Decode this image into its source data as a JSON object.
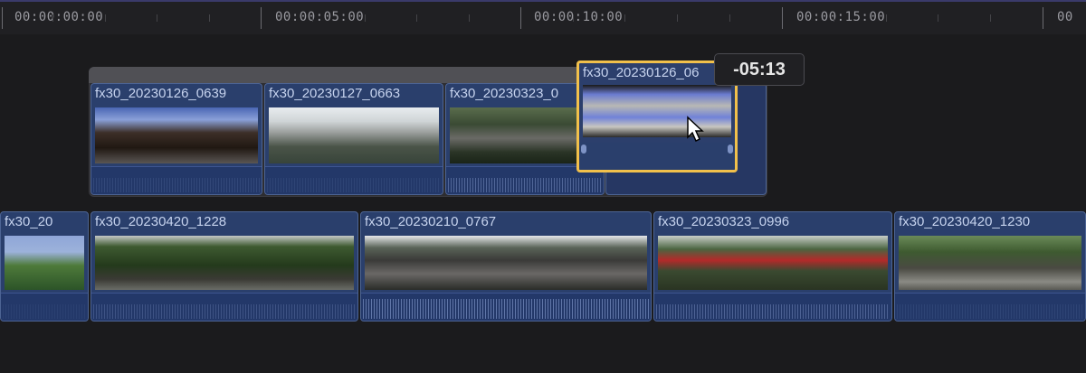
{
  "timeline": {
    "ruler_labels": [
      "00:00:00:00",
      "00:00:05:00",
      "00:00:10:00",
      "00:00:15:00",
      "00"
    ],
    "drag_offset": "-05:13"
  },
  "storyline_clips": [
    {
      "name": "fx30_20230126_0639"
    },
    {
      "name": "fx30_20230127_0663"
    },
    {
      "name": "fx30_20230323_0"
    },
    {
      "name": "fx30_20230126_06"
    }
  ],
  "primary_clips": [
    {
      "name": "fx30_20"
    },
    {
      "name": "fx30_20230420_1228"
    },
    {
      "name": "fx30_20230210_0767"
    },
    {
      "name": "fx30_20230323_0996"
    },
    {
      "name": "fx30_20230420_1230"
    }
  ],
  "colors": {
    "clip_blue": "#2a3f6c",
    "selection_yellow": "#f1c04b",
    "background": "#1b1b1d"
  },
  "icons": [
    "pointer-cursor-icon"
  ]
}
